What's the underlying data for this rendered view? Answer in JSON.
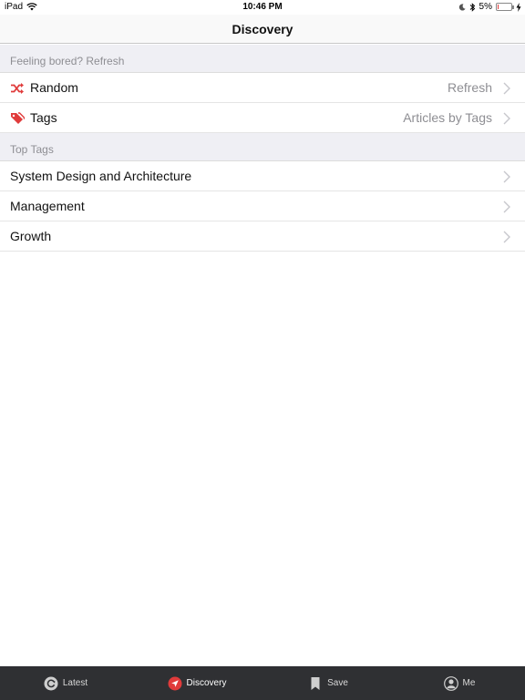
{
  "status_bar": {
    "device": "iPad",
    "time": "10:46 PM",
    "battery": "5%",
    "battery_level": 0.05
  },
  "nav": {
    "title": "Discovery"
  },
  "sections": [
    {
      "header": "Feeling bored? Refresh",
      "rows": [
        {
          "label": "Random",
          "detail": "Refresh",
          "icon": "shuffle-icon"
        },
        {
          "label": "Tags",
          "detail": "Articles by Tags",
          "icon": "tags-icon"
        }
      ]
    },
    {
      "header": "Top Tags",
      "rows": [
        {
          "label": "System Design and Architecture"
        },
        {
          "label": "Management"
        },
        {
          "label": "Growth"
        }
      ]
    }
  ],
  "tabs": [
    {
      "label": "Latest",
      "icon": "refresh-icon"
    },
    {
      "label": "Discovery",
      "icon": "compass-icon",
      "active": true
    },
    {
      "label": "Save",
      "icon": "bookmark-icon"
    },
    {
      "label": "Me",
      "icon": "user-icon"
    }
  ],
  "colors": {
    "accent": "#e03b3b",
    "tab_bar": "#2f3033",
    "section_bg": "#efeff4"
  }
}
